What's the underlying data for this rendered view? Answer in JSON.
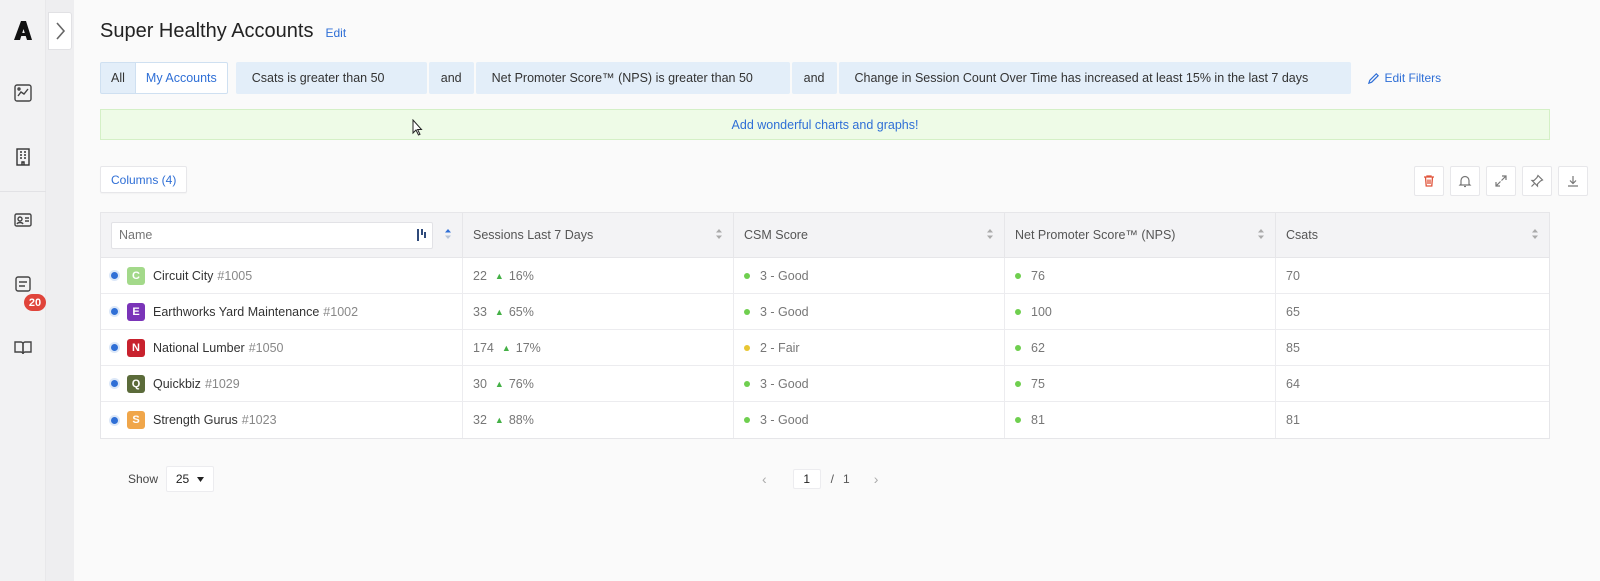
{
  "app": {
    "logo_letter": "A",
    "notification_count": "20"
  },
  "page": {
    "title": "Super Healthy Accounts",
    "edit_label": "Edit"
  },
  "filters": {
    "tabs": [
      "All",
      "My Accounts"
    ],
    "active_tab": "My Accounts",
    "conditions": [
      "Csats is greater than 50",
      "Net Promoter Score™ (NPS) is greater than 50",
      "Change in Session Count Over Time has increased at least 15% in the last 7 days"
    ],
    "joiner": "and",
    "edit_filters_label": "Edit Filters"
  },
  "banner": {
    "text": "Add wonderful charts and graphs!"
  },
  "columns_button": "Columns (4)",
  "table": {
    "name_placeholder": "Name",
    "headers": [
      "Sessions Last 7 Days",
      "CSM Score",
      "Net Promoter Score™ (NPS)",
      "Csats"
    ],
    "rows": [
      {
        "initial": "C",
        "color": "#a3d98a",
        "name": "Circuit City",
        "id": "#1005",
        "sessions": "22",
        "trend": "16%",
        "csm": "3 - Good",
        "csm_color": "#6fcf4f",
        "nps": "76",
        "csat": "70"
      },
      {
        "initial": "E",
        "color": "#7a34b8",
        "name": "Earthworks Yard Maintenance",
        "id": "#1002",
        "sessions": "33",
        "trend": "65%",
        "csm": "3 - Good",
        "csm_color": "#6fcf4f",
        "nps": "100",
        "csat": "65"
      },
      {
        "initial": "N",
        "color": "#c8222e",
        "name": "National Lumber",
        "id": "#1050",
        "sessions": "174",
        "trend": "17%",
        "csm": "2 - Fair",
        "csm_color": "#e8c633",
        "nps": "62",
        "csat": "85"
      },
      {
        "initial": "Q",
        "color": "#5b6b3a",
        "name": "Quickbiz",
        "id": "#1029",
        "sessions": "30",
        "trend": "76%",
        "csm": "3 - Good",
        "csm_color": "#6fcf4f",
        "nps": "75",
        "csat": "64"
      },
      {
        "initial": "S",
        "color": "#f0a64a",
        "name": "Strength Gurus",
        "id": "#1023",
        "sessions": "32",
        "trend": "88%",
        "csm": "3 - Good",
        "csm_color": "#6fcf4f",
        "nps": "81",
        "csat": "81"
      }
    ]
  },
  "footer": {
    "show_label": "Show",
    "page_size": "25",
    "current_page": "1",
    "page_separator": "/",
    "total_pages": "1"
  },
  "colors": {
    "accent": "#2f6fd6",
    "delete": "#e0533a",
    "positive": "#44b046",
    "nps_dot": "#6fcf4f"
  }
}
